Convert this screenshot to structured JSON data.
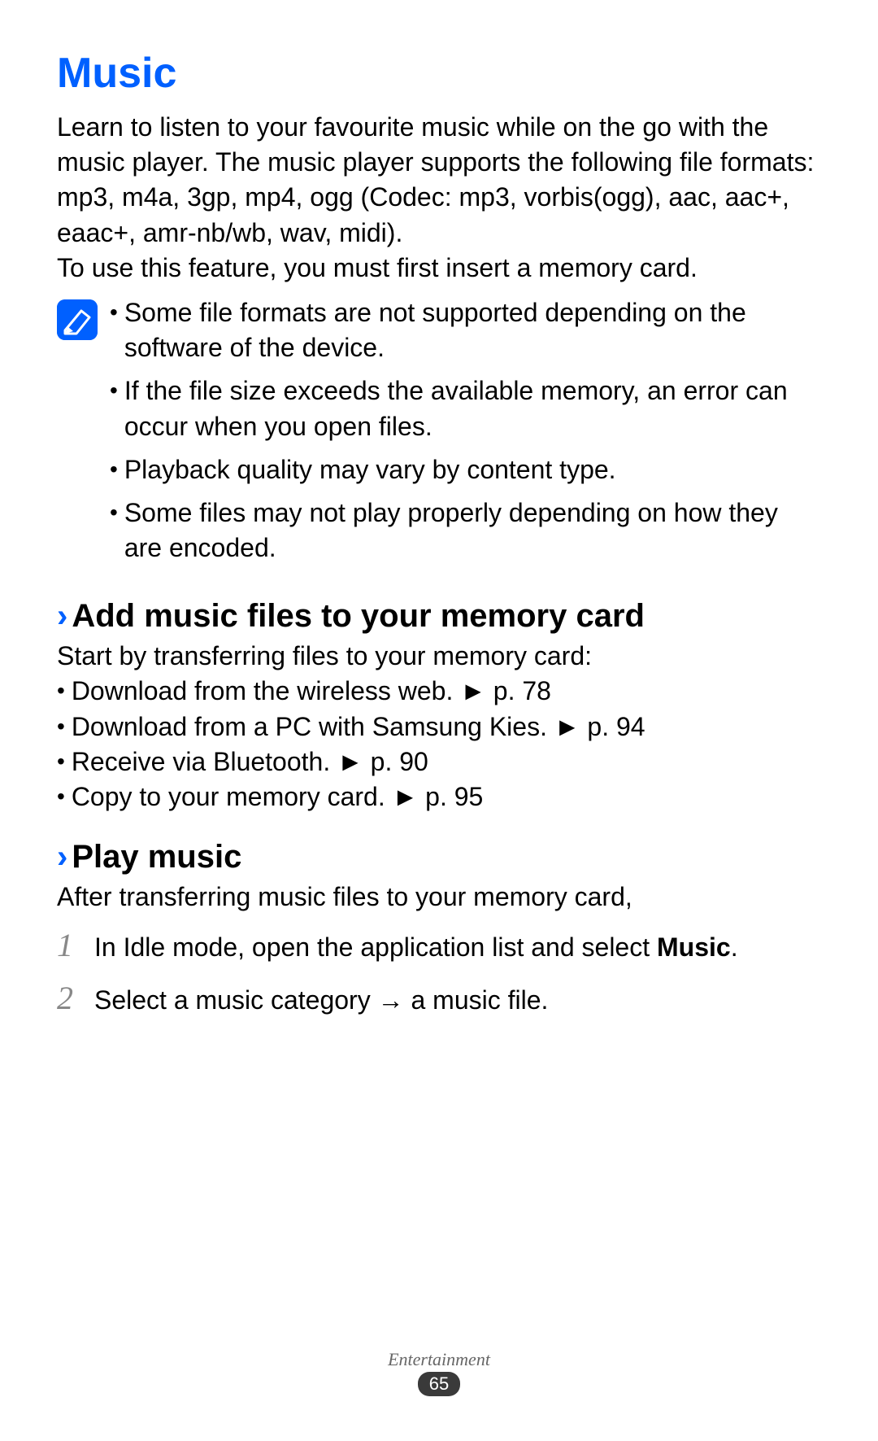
{
  "heading": "Music",
  "intro": "Learn to listen to your favourite music while on the go with the music player. The music player supports the following file formats: mp3, m4a, 3gp, mp4, ogg (Codec: mp3, vorbis(ogg), aac, aac+, eaac+, amr-nb/wb, wav, midi).",
  "notice": "To use this feature, you must first insert a memory card.",
  "notes": [
    "Some file formats are not supported depending on the software of the device.",
    "If the file size exceeds the available memory, an error can occur when you open files.",
    "Playback quality may vary by content type.",
    "Some files may not play properly depending on how they are encoded."
  ],
  "section1": {
    "title": "Add music files to your memory card",
    "intro": "Start by transferring files to your memory card:",
    "items": [
      "Download from the wireless web. ► p. 78",
      "Download from a PC with Samsung Kies. ► p. 94",
      "Receive via Bluetooth. ► p. 90",
      "Copy to your memory card. ► p. 95"
    ]
  },
  "section2": {
    "title": "Play music",
    "intro": "After transferring music files to your memory card,",
    "steps": [
      {
        "num": "1",
        "prefix": "In Idle mode, open the application list and select ",
        "bold": "Music",
        "suffix": "."
      },
      {
        "num": "2",
        "prefix": "Select a music category → a music file.",
        "bold": "",
        "suffix": ""
      }
    ]
  },
  "footer": {
    "category": "Entertainment",
    "page": "65"
  }
}
